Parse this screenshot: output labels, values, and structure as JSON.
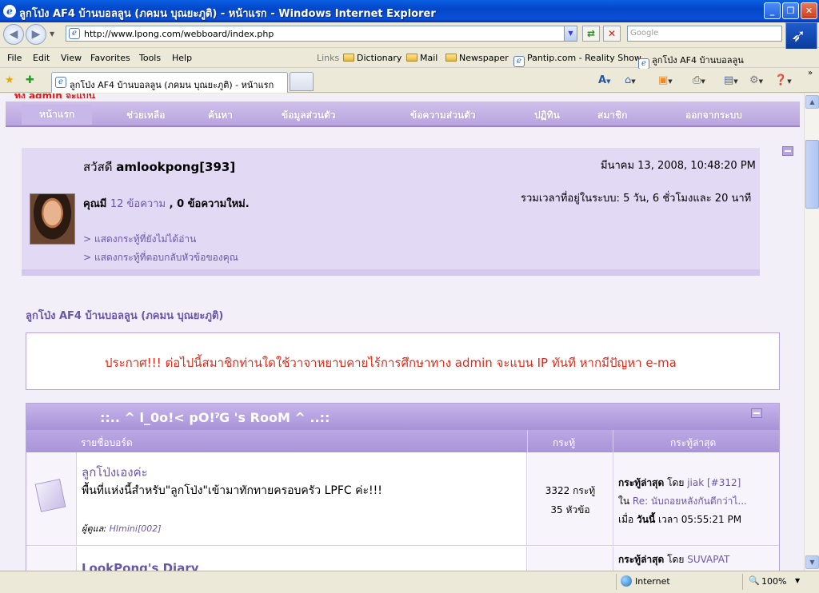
{
  "window": {
    "title": "ลูกโป่ง AF4 บ้านบอลลูน (ภคมน บุณยะภูติ) - หน้าแรก - Windows Internet Explorer"
  },
  "address": {
    "url": "http://www.lpong.com/webboard/index.php",
    "search_placeholder": "Google"
  },
  "menu": {
    "items": [
      "File",
      "Edit",
      "View",
      "Favorites",
      "Tools",
      "Help"
    ]
  },
  "links": {
    "label": "Links",
    "items": [
      "Dictionary",
      "Mail",
      "Newspaper",
      "Pantip.com - Reality Show",
      "ลูกโป่ง AF4 บ้านบอลลูน"
    ]
  },
  "tab": {
    "label": "ลูกโป่ง AF4 บ้านบอลลูน (ภคมน บุณยะภูติ) - หน้าแรก"
  },
  "forum_nav": {
    "top_notice": "ทั้ง admin จะแบน",
    "items": [
      "หน้าแรก",
      "ช่วยเหลือ",
      "ค้นหา",
      "ข้อมูลส่วนตัว",
      "ข้อความส่วนตัว",
      "ปฏิทิน",
      "สมาชิก",
      "ออกจากระบบ"
    ]
  },
  "welcome": {
    "greeting": "สวัสดี",
    "username": "amlookpong[393]",
    "datetime": "มีนาคม 13, 2008, 10:48:20 PM",
    "you_have": "คุณมี",
    "messages": "12 ข้อความ",
    "new_messages": ", 0 ข้อความใหม่.",
    "online_time": "รวมเวลาที่อยู่ในระบบ: 5 วัน, 6 ชั่วโมงและ 20 นาที",
    "link_unread": "> แสดงกระทู้ที่ยังไม่ได้อ่าน",
    "link_replies": "> แสดงกระทู้ที่ตอบกลับหัวข้อของคุณ"
  },
  "board": {
    "title": "ลูกโป่ง AF4 บ้านบอลลูน (ภคมน บุณยะภูติ)",
    "announcement": "ประกาศ!!! ต่อไปนี้สมาชิกท่านใดใช้วาจาหยาบคายไร้การศึกษาทาง admin จะแบน IP ทันที หากมีปัญหา e-ma",
    "category": "::.. ^ l_0o!< pO!ˀG 's RooM ^ ..::",
    "col_boards": "รายชื่อบอร์ด",
    "col_topics": "กระทู้",
    "col_last": "กระทู้ล่าสุด",
    "rows": [
      {
        "name": "ลูกโป่งเองค่ะ",
        "desc": "พื้นที่แห่งนี้สำหรับ\"ลูกโป่ง\"เข้ามาทักทายครอบครัว LPFC ค่ะ!!!",
        "moderator_label": "ผู้ดูแล:",
        "moderator": "HImini[002]",
        "posts": "3322 กระทู้",
        "topics": "35 หัวข้อ",
        "last_label": "กระทู้ล่าสุด",
        "last_by": "โดย",
        "last_user": "jiak [#312]",
        "last_in": "ใน",
        "last_topic": "Re: นับถอยหลังกันดีกว่าไ...",
        "last_when": "เมื่อ",
        "last_today": "วันนี้",
        "last_time": "เวลา 05:55:21 PM"
      },
      {
        "name": "LookPong's Diary",
        "last_label": "กระทู้ล่าสุด",
        "last_by": "โดย",
        "last_user": "SUVAPAT"
      }
    ]
  },
  "statusbar": {
    "zone": "Internet",
    "zoom": "100%"
  }
}
